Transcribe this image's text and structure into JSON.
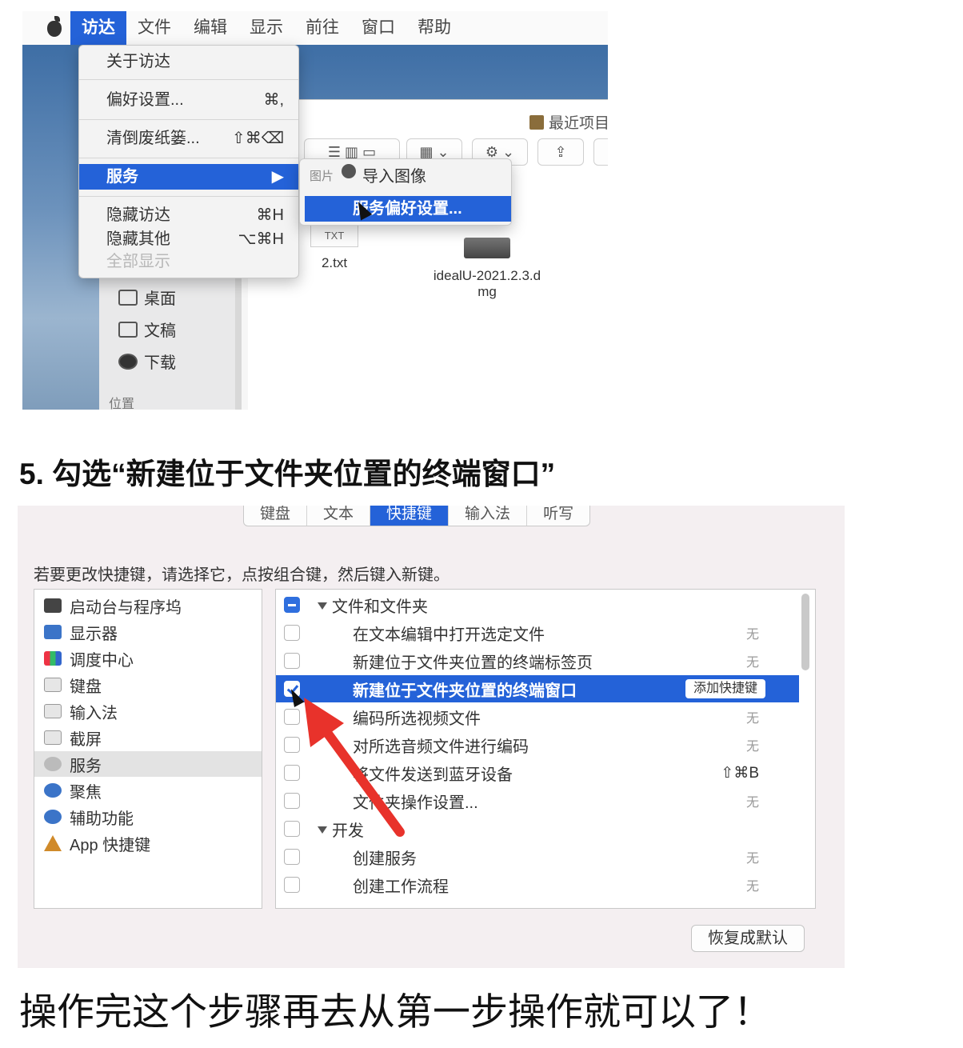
{
  "menubar": {
    "items": [
      "访达",
      "文件",
      "编辑",
      "显示",
      "前往",
      "窗口",
      "帮助"
    ],
    "active_index": 0
  },
  "finder_menu": {
    "about": "关于访达",
    "prefs": "偏好设置...",
    "prefs_shortcut": "⌘,",
    "empty_trash": "清倒废纸篓...",
    "empty_trash_shortcut": "⇧⌘⌫",
    "services": "服务",
    "services_arrow": "▶",
    "hide_finder": "隐藏访达",
    "hide_finder_shortcut": "⌘H",
    "hide_others": "隐藏其他",
    "hide_others_shortcut": "⌥⌘H",
    "show_all": "全部显示"
  },
  "services_submenu": {
    "group_label": "图片",
    "import_images": "导入图像",
    "service_prefs": "服务偏好设置..."
  },
  "finder_window": {
    "title": "最近项目",
    "sidebar": {
      "items": [
        "桌面",
        "文稿",
        "下载"
      ],
      "section_location": "位置"
    },
    "files": [
      {
        "icon_label": "TXT",
        "name": "2.txt"
      },
      {
        "name_line1": "idealU-2021.2.3.d",
        "name_line2": "mg"
      }
    ]
  },
  "step_heading": "5. 勾选“新建位于文件夹位置的终端窗口”",
  "keyboard_prefs": {
    "tabs": [
      "键盘",
      "文本",
      "快捷键",
      "输入法",
      "听写"
    ],
    "active_tab": 2,
    "instruction": "若要更改快捷键，请选择它，点按组合键，然后键入新键。",
    "categories": [
      "启动台与程序坞",
      "显示器",
      "调度中心",
      "键盘",
      "输入法",
      "截屏",
      "服务",
      "聚焦",
      "辅助功能",
      "App 快捷键"
    ],
    "selected_category": 6,
    "services": [
      {
        "label": "文件和文件夹",
        "group": true,
        "state": "mixed"
      },
      {
        "label": "在文本编辑中打开选定文件",
        "key": "无",
        "state": "off"
      },
      {
        "label": "新建位于文件夹位置的终端标签页",
        "key": "无",
        "state": "off"
      },
      {
        "label": "新建位于文件夹位置的终端窗口",
        "button": "添加快捷键",
        "state": "on",
        "highlighted": true
      },
      {
        "label": "编码所选视频文件",
        "key": "无",
        "state": "off"
      },
      {
        "label": "对所选音频文件进行编码",
        "key": "无",
        "state": "off"
      },
      {
        "label": "将文件发送到蓝牙设备",
        "key": "⇧⌘B",
        "state": "off"
      },
      {
        "label": "文件夹操作设置...",
        "key": "无",
        "state": "off"
      },
      {
        "label": "开发",
        "group": true,
        "state": "off"
      },
      {
        "label": "创建服务",
        "key": "无",
        "state": "off"
      },
      {
        "label": "创建工作流程",
        "key": "无",
        "state": "off"
      }
    ],
    "restore_button": "恢复成默认"
  },
  "footer": "操作完这个步骤再去从第一步操作就可以了！",
  "colors": {
    "highlight": "#2462d8",
    "annotation_arrow": "#e8322b"
  }
}
